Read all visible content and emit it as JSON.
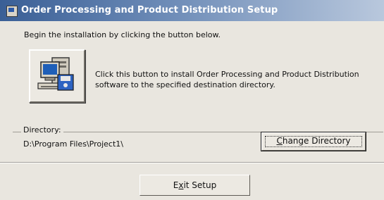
{
  "window": {
    "title": "Order Processing and Product Distribution Setup"
  },
  "intro_text": "Begin the installation by clicking the button below.",
  "install": {
    "icon": "computer-setup-icon",
    "description": "Click this button to install Order Processing and Product Distribution software to the specified destination directory."
  },
  "directory": {
    "label": "Directory:",
    "path": "D:\\Program Files\\Project1\\",
    "change_button": {
      "accel": "C",
      "rest": "hange Directory"
    }
  },
  "exit_button": {
    "pre": "E",
    "accel": "x",
    "rest": "it Setup"
  },
  "colors": {
    "title_bar_start": "#3a5f96",
    "title_bar_end": "#b9c8dd",
    "dialog_background": "#e9e6df"
  }
}
